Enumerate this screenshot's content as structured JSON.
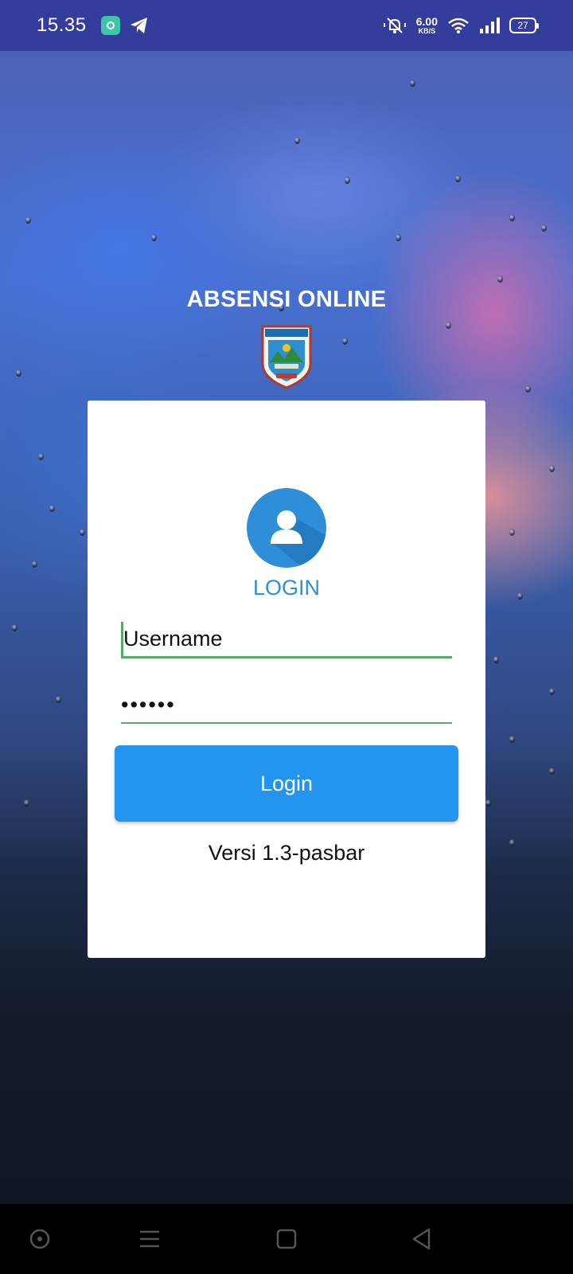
{
  "status_bar": {
    "time": "15.35",
    "speed_value": "6.00",
    "speed_unit": "KB/S",
    "battery": "27",
    "icons": [
      "app-notification-icon",
      "telegram-icon",
      "silent-bell-icon",
      "wifi-icon",
      "signal-icon",
      "battery-icon"
    ]
  },
  "header": {
    "title": "ABSENSI ONLINE",
    "emblem_icon": "pasaman-barat-emblem"
  },
  "login_card": {
    "avatar_icon": "user-avatar-icon",
    "heading": "LOGIN",
    "username_placeholder": "Username",
    "password_value": "••••••",
    "login_button_label": "Login",
    "version": "Versi 1.3-pasbar"
  },
  "nav_bar": {
    "buttons": [
      "assistant-button",
      "menu-button",
      "home-button",
      "back-button"
    ]
  },
  "colors": {
    "status_bar": "#343c9c",
    "accent_blue": "#2395ef",
    "heading_blue": "#2e8fd8",
    "field_underline": "#5aa865"
  }
}
